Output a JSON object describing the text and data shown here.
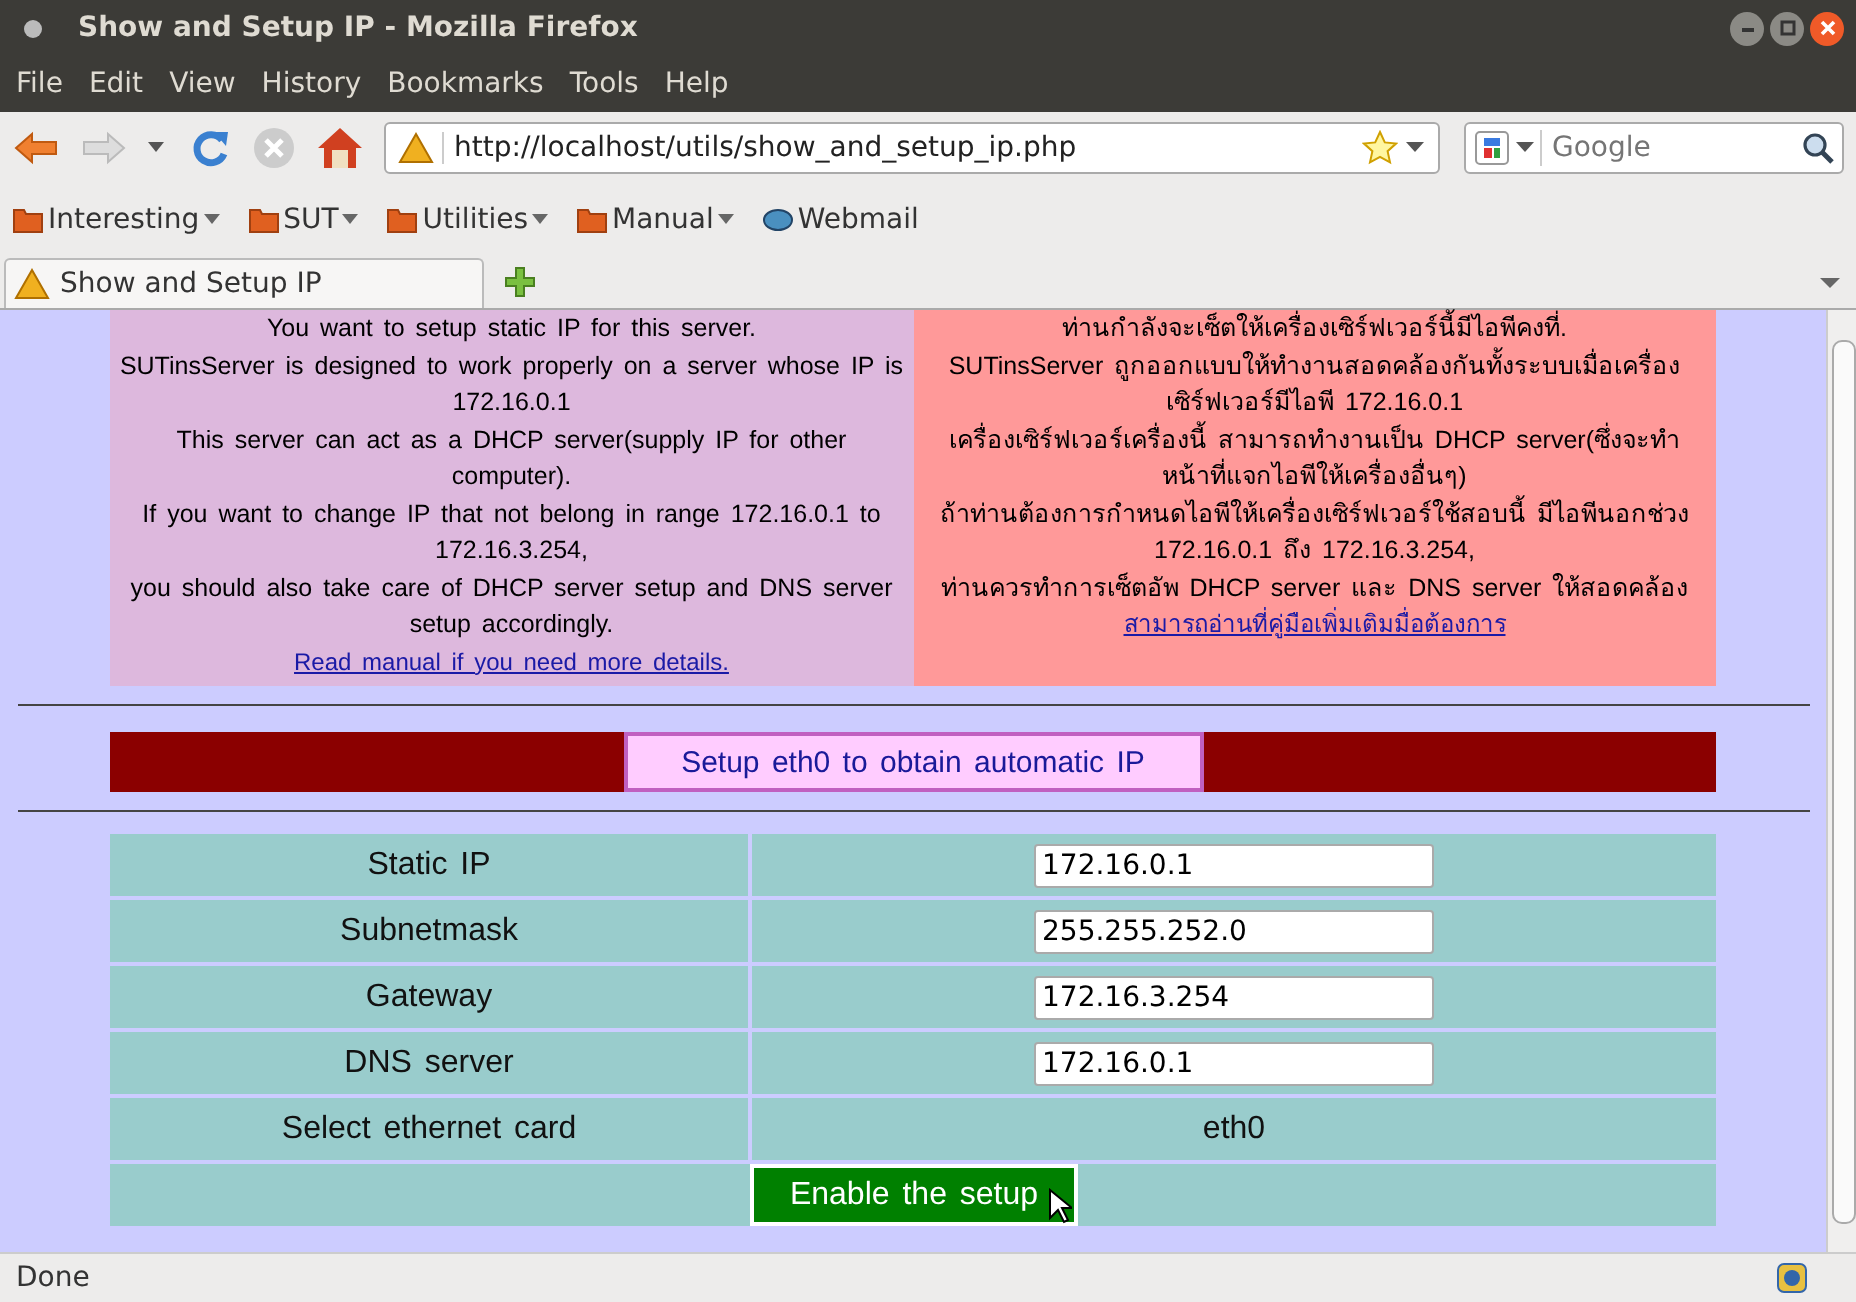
{
  "window": {
    "title": "Show and Setup IP - Mozilla Firefox"
  },
  "menu": [
    "File",
    "Edit",
    "View",
    "History",
    "Bookmarks",
    "Tools",
    "Help"
  ],
  "address_bar": {
    "value": "http://localhost/utils/show_and_setup_ip.php"
  },
  "search": {
    "placeholder": "Google"
  },
  "bookmarks": [
    {
      "label": "Interesting",
      "kind": "folder"
    },
    {
      "label": "SUT",
      "kind": "folder"
    },
    {
      "label": "Utilities",
      "kind": "folder"
    },
    {
      "label": "Manual",
      "kind": "folder"
    },
    {
      "label": "Webmail",
      "kind": "link"
    }
  ],
  "tabs": [
    {
      "label": "Show and Setup IP",
      "selected": true
    }
  ],
  "info_panels": [
    {
      "lines": [
        "You want to setup static IP for this server.",
        "SUTinsServer is designed to work properly on a server whose IP is 172.16.0.1",
        "This server can act as a DHCP server(supply IP for other computer).",
        "If you want to change IP that not belong in range 172.16.0.1 to 172.16.3.254,",
        "you should also take care of DHCP server setup and DNS server setup accordingly."
      ],
      "link": "Read manual if you need more details."
    },
    {
      "lines": [
        "ท่านกำลังจะเซ็ตให้เครื่องเซิร์ฟเวอร์นี้มีไอพีคงที่.",
        "SUTinsServer ถูกออกแบบให้ทำงานสอดคล้องกันทั้งระบบเมื่อเครื่องเซิร์ฟเวอร์มีไอพี 172.16.0.1",
        "เครื่องเซิร์ฟเวอร์เครื่องนี้ สามารถทำงานเป็น DHCP server(ซึ่งจะทำหน้าที่แจกไอพีให้เครื่องอื่นๆ)",
        "ถ้าท่านต้องการกำหนดไอพีให้เครื่องเซิร์ฟเวอร์ใช้สอบนี้ มีไอพีนอกช่วง 172.16.0.1 ถึง 172.16.3.254,",
        "ท่านควรทำการเซ็ตอัพ DHCP server และ DNS server ให้สอดคล้อง"
      ],
      "link": "สามารถอ่านที่คู่มือเพิ่มเติมมื่อต้องการ"
    }
  ],
  "auto_ip_button": "Setup eth0 to obtain automatic IP",
  "form": {
    "rows": [
      {
        "label": "Static IP",
        "kind": "input",
        "value": "172.16.0.1"
      },
      {
        "label": "Subnetmask",
        "kind": "input",
        "value": "255.255.252.0"
      },
      {
        "label": "Gateway",
        "kind": "input",
        "value": "172.16.3.254"
      },
      {
        "label": "DNS server",
        "kind": "input",
        "value": "172.16.0.1"
      },
      {
        "label": "Select ethernet card",
        "kind": "text",
        "value": "eth0"
      }
    ],
    "submit": "Enable the setup"
  },
  "status_bar": "Done"
}
